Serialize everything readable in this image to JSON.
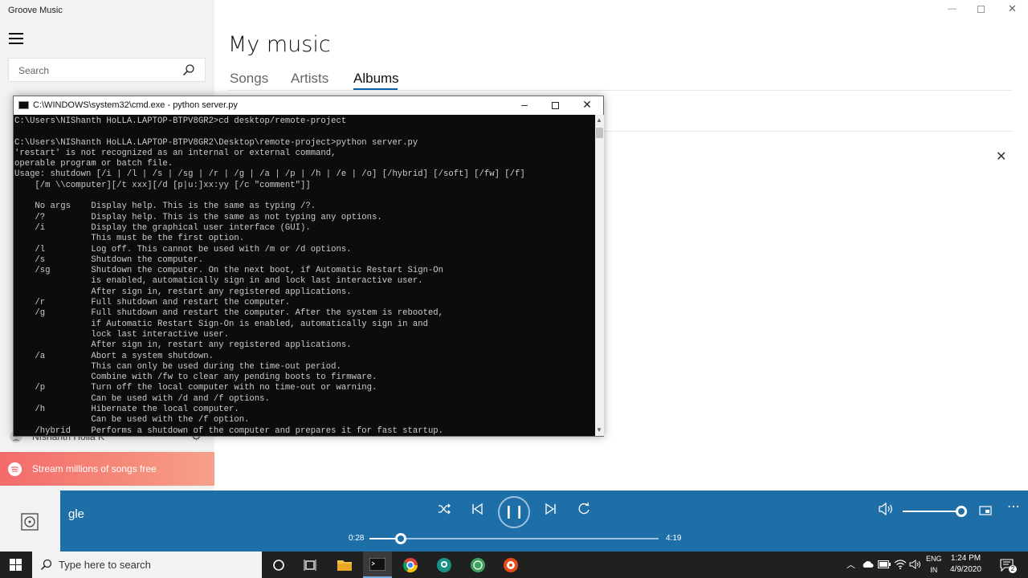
{
  "app": {
    "title": "Groove Music"
  },
  "sidebar": {
    "search_placeholder": "Search",
    "user_name": "NIshanth Holla K",
    "promo_text": "Stream millions of songs free"
  },
  "main": {
    "title": "My music",
    "tabs": [
      {
        "label": "Songs"
      },
      {
        "label": "Artists"
      },
      {
        "label": "Albums",
        "selected": true
      }
    ]
  },
  "cmd": {
    "title": "C:\\WINDOWS\\system32\\cmd.exe - python  server.py",
    "output": "C:\\Users\\NIShanth HoLLA.LAPTOP-BTPV8GR2>cd desktop/remote-project\n\nC:\\Users\\NIShanth HoLLA.LAPTOP-BTPV8GR2\\Desktop\\remote-project>python server.py\n'restart' is not recognized as an internal or external command,\noperable program or batch file.\nUsage: shutdown [/i | /l | /s | /sg | /r | /g | /a | /p | /h | /e | /o] [/hybrid] [/soft] [/fw] [/f]\n    [/m \\\\computer][/t xxx][/d [p|u:]xx:yy [/c \"comment\"]]\n\n    No args    Display help. This is the same as typing /?.\n    /?         Display help. This is the same as not typing any options.\n    /i         Display the graphical user interface (GUI).\n               This must be the first option.\n    /l         Log off. This cannot be used with /m or /d options.\n    /s         Shutdown the computer.\n    /sg        Shutdown the computer. On the next boot, if Automatic Restart Sign-On\n               is enabled, automatically sign in and lock last interactive user.\n               After sign in, restart any registered applications.\n    /r         Full shutdown and restart the computer.\n    /g         Full shutdown and restart the computer. After the system is rebooted,\n               if Automatic Restart Sign-On is enabled, automatically sign in and\n               lock last interactive user.\n               After sign in, restart any registered applications.\n    /a         Abort a system shutdown.\n               This can only be used during the time-out period.\n               Combine with /fw to clear any pending boots to firmware.\n    /p         Turn off the local computer with no time-out or warning.\n               Can be used with /d and /f options.\n    /h         Hibernate the local computer.\n               Can be used with the /f option.\n    /hybrid    Performs a shutdown of the computer and prepares it for fast startup."
  },
  "player": {
    "track_title": "gle",
    "elapsed": "0:28",
    "duration": "4:19",
    "progress": 0.108,
    "volume": 1.0,
    "accent": "#1e6ea7"
  },
  "taskbar": {
    "search_placeholder": "Type here to search",
    "lang_line1": "ENG",
    "lang_line2": "IN",
    "time": "1:24 PM",
    "date": "4/9/2020",
    "notification_count": "2"
  }
}
